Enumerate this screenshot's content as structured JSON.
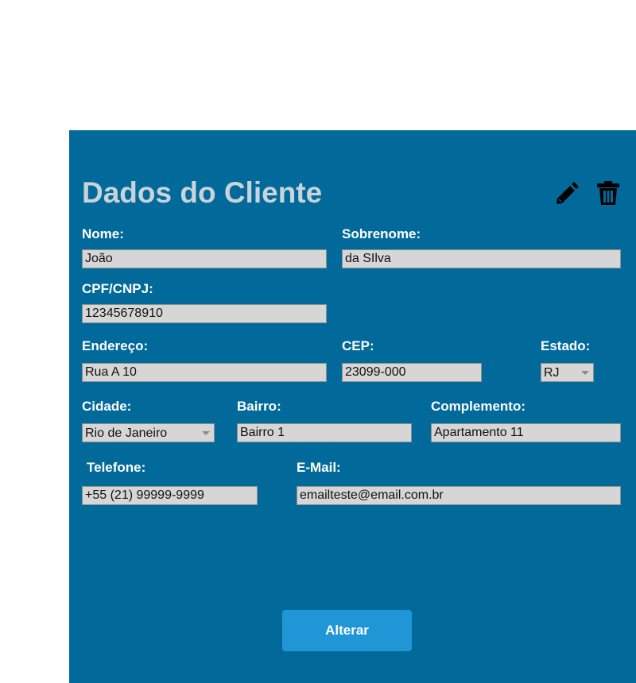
{
  "title": "Dados do Cliente",
  "icons": {
    "edit": "pencil-icon",
    "delete": "trash-icon"
  },
  "fields": {
    "nome": {
      "label": "Nome:",
      "value": "João"
    },
    "sobrenome": {
      "label": "Sobrenome:",
      "value": "da SIlva"
    },
    "cpf": {
      "label": "CPF/CNPJ:",
      "value": "12345678910"
    },
    "endereco": {
      "label": "Endereço:",
      "value": "Rua A 10"
    },
    "cep": {
      "label": "CEP:",
      "value": "23099-000"
    },
    "estado": {
      "label": "Estado:",
      "value": "RJ"
    },
    "cidade": {
      "label": "Cidade:",
      "value": "Rio de Janeiro"
    },
    "bairro": {
      "label": "Bairro:",
      "value": "Bairro 1"
    },
    "complemento": {
      "label": "Complemento:",
      "value": "Apartamento 11"
    },
    "telefone": {
      "label": "Telefone:",
      "value": "+55 (21) 99999-9999"
    },
    "email": {
      "label": "E-Mail:",
      "value": "emailteste@email.com.br"
    }
  },
  "submit_label": "Alterar",
  "colors": {
    "panel": "#026a9b",
    "title": "#c9d3da",
    "field_bg": "#d6d6d6",
    "button": "#2196d6"
  }
}
